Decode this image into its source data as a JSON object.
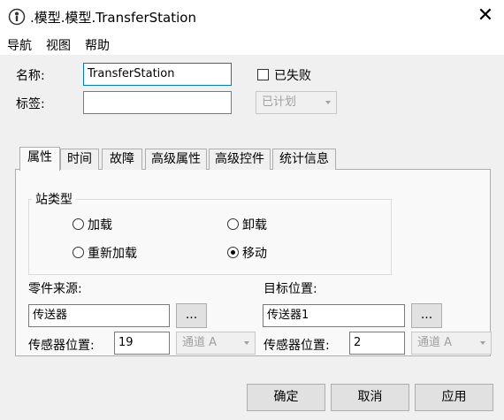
{
  "window": {
    "title": ".模型.模型.TransferStation"
  },
  "menu": [
    "导航",
    "视图",
    "帮助"
  ],
  "form": {
    "name_label": "名称:",
    "name_value": "TransferStation",
    "tag_label": "标签:",
    "tag_value": "",
    "failed_label": "已失败",
    "failed_checked": false,
    "planned_value": "已计划"
  },
  "tabs": [
    "属性",
    "时间",
    "故障",
    "高级属性",
    "高级控件",
    "统计信息"
  ],
  "station_type": {
    "legend": "站类型",
    "options": [
      {
        "label": "加载",
        "selected": false
      },
      {
        "label": "卸载",
        "selected": false
      },
      {
        "label": "重新加载",
        "selected": false
      },
      {
        "label": "移动",
        "selected": true
      }
    ]
  },
  "source": {
    "label": "零件来源:",
    "value": "传送器",
    "browse_label": "...",
    "sensor_label": "传感器位置:",
    "sensor_value": "19",
    "channel_value": "通道 A"
  },
  "target": {
    "label": "目标位置:",
    "value": "传送器1",
    "browse_label": "...",
    "sensor_label": "传感器位置:",
    "sensor_value": "2",
    "channel_value": "通道 A"
  },
  "buttons": {
    "ok": "确定",
    "cancel": "取消",
    "apply": "应用"
  }
}
